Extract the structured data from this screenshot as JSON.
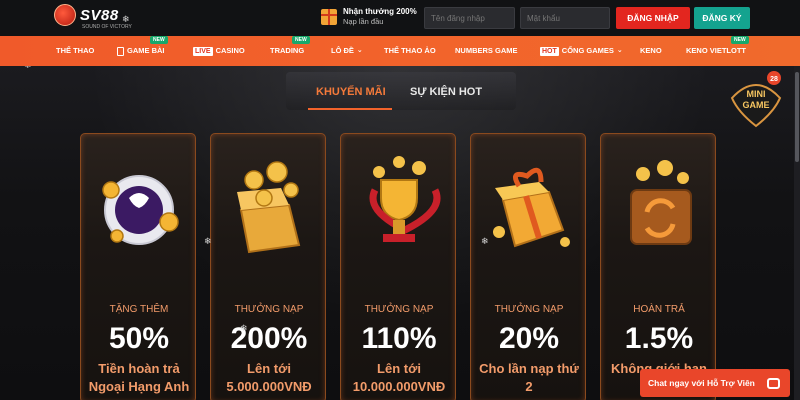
{
  "header": {
    "logo_text": "SV88",
    "logo_tagline": "SOUND OF VICTORY",
    "promo_title": "Nhận thưởng 200%",
    "promo_subtitle": "Nạp lần đầu",
    "username_placeholder": "Tên đăng nhập",
    "password_placeholder": "Mật khẩu",
    "login_label": "ĐĂNG NHẬP",
    "register_label": "ĐĂNG KÝ"
  },
  "nav": {
    "items": [
      {
        "label": "THỂ THAO"
      },
      {
        "label": "GAME BÀI",
        "badge": "NEW"
      },
      {
        "label": "CASINO",
        "tag": "LIVE"
      },
      {
        "label": "TRADING",
        "badge": "NEW"
      },
      {
        "label": "LÔ ĐỀ"
      },
      {
        "label": "THỂ THAO ẢO"
      },
      {
        "label": "NUMBERS GAME"
      },
      {
        "label": "CỔNG GAMES",
        "tag": "HOT"
      },
      {
        "label": "KENO"
      },
      {
        "label": "KENO VIETLOTT",
        "badge": "NEW"
      }
    ]
  },
  "tabs": [
    {
      "label": "KHUYẾN MÃI",
      "active": true
    },
    {
      "label": "SỰ KIỆN HOT",
      "active": false
    }
  ],
  "cards": [
    {
      "label": "TẶNG THÊM",
      "value": "50%",
      "desc_line1": "Tiền hoàn trả",
      "desc_line2": "Ngoại Hạng Anh",
      "art": "premier-league-ball"
    },
    {
      "label": "THƯỞNG NẠP",
      "value": "200%",
      "desc_line1": "Lên tới",
      "desc_line2": "5.000.000VNĐ",
      "art": "coin-box"
    },
    {
      "label": "THƯỞNG NẠP",
      "value": "110%",
      "desc_line1": "Lên tới",
      "desc_line2": "10.000.000VNĐ",
      "art": "trophy"
    },
    {
      "label": "THƯỞNG NẠP",
      "value": "20%",
      "desc_line1": "Cho lần nạp thứ",
      "desc_line2": "2",
      "art": "gift-box"
    },
    {
      "label": "HOÀN TRẢ",
      "value": "1.5%",
      "desc_line1": "Không giới hạn",
      "desc_line2": "",
      "art": "refund-wallet"
    }
  ],
  "minigame": {
    "line1": "MINI",
    "line2": "GAME",
    "number": "28"
  },
  "chat": {
    "label": "Chat ngay với Hỗ Trợ Viên"
  },
  "colors": {
    "accent": "#f2632b",
    "login": "#e3261f",
    "register": "#14a38f",
    "card_text": "#f29b6a"
  }
}
